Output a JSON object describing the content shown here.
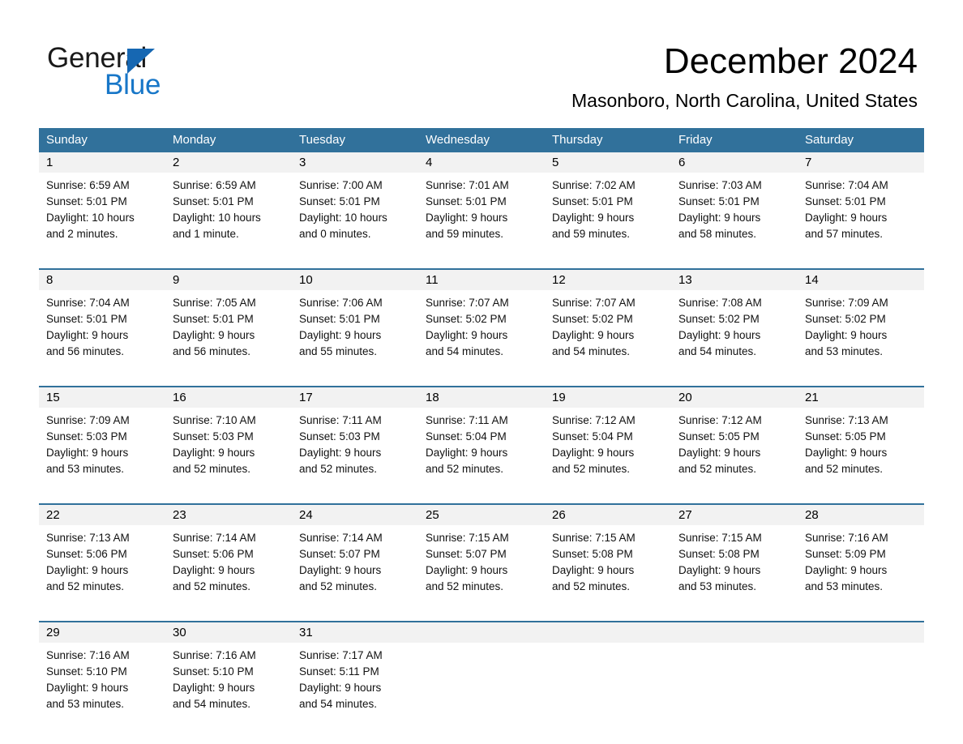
{
  "brand": {
    "name_part1": "General",
    "name_part2": "Blue",
    "accent_color": "#1877c8",
    "triangle_color": "#1667b2"
  },
  "header": {
    "title": "December 2024",
    "subtitle": "Masonboro, North Carolina, United States"
  },
  "calendar": {
    "header_bg": "#31719b",
    "header_text_color": "#ffffff",
    "daynumber_bg": "#f2f2f2",
    "weekdays": [
      "Sunday",
      "Monday",
      "Tuesday",
      "Wednesday",
      "Thursday",
      "Friday",
      "Saturday"
    ],
    "weeks": [
      [
        {
          "day": "1",
          "sunrise": "Sunrise: 6:59 AM",
          "sunset": "Sunset: 5:01 PM",
          "daylight_line1": "Daylight: 10 hours",
          "daylight_line2": "and 2 minutes."
        },
        {
          "day": "2",
          "sunrise": "Sunrise: 6:59 AM",
          "sunset": "Sunset: 5:01 PM",
          "daylight_line1": "Daylight: 10 hours",
          "daylight_line2": "and 1 minute."
        },
        {
          "day": "3",
          "sunrise": "Sunrise: 7:00 AM",
          "sunset": "Sunset: 5:01 PM",
          "daylight_line1": "Daylight: 10 hours",
          "daylight_line2": "and 0 minutes."
        },
        {
          "day": "4",
          "sunrise": "Sunrise: 7:01 AM",
          "sunset": "Sunset: 5:01 PM",
          "daylight_line1": "Daylight: 9 hours",
          "daylight_line2": "and 59 minutes."
        },
        {
          "day": "5",
          "sunrise": "Sunrise: 7:02 AM",
          "sunset": "Sunset: 5:01 PM",
          "daylight_line1": "Daylight: 9 hours",
          "daylight_line2": "and 59 minutes."
        },
        {
          "day": "6",
          "sunrise": "Sunrise: 7:03 AM",
          "sunset": "Sunset: 5:01 PM",
          "daylight_line1": "Daylight: 9 hours",
          "daylight_line2": "and 58 minutes."
        },
        {
          "day": "7",
          "sunrise": "Sunrise: 7:04 AM",
          "sunset": "Sunset: 5:01 PM",
          "daylight_line1": "Daylight: 9 hours",
          "daylight_line2": "and 57 minutes."
        }
      ],
      [
        {
          "day": "8",
          "sunrise": "Sunrise: 7:04 AM",
          "sunset": "Sunset: 5:01 PM",
          "daylight_line1": "Daylight: 9 hours",
          "daylight_line2": "and 56 minutes."
        },
        {
          "day": "9",
          "sunrise": "Sunrise: 7:05 AM",
          "sunset": "Sunset: 5:01 PM",
          "daylight_line1": "Daylight: 9 hours",
          "daylight_line2": "and 56 minutes."
        },
        {
          "day": "10",
          "sunrise": "Sunrise: 7:06 AM",
          "sunset": "Sunset: 5:01 PM",
          "daylight_line1": "Daylight: 9 hours",
          "daylight_line2": "and 55 minutes."
        },
        {
          "day": "11",
          "sunrise": "Sunrise: 7:07 AM",
          "sunset": "Sunset: 5:02 PM",
          "daylight_line1": "Daylight: 9 hours",
          "daylight_line2": "and 54 minutes."
        },
        {
          "day": "12",
          "sunrise": "Sunrise: 7:07 AM",
          "sunset": "Sunset: 5:02 PM",
          "daylight_line1": "Daylight: 9 hours",
          "daylight_line2": "and 54 minutes."
        },
        {
          "day": "13",
          "sunrise": "Sunrise: 7:08 AM",
          "sunset": "Sunset: 5:02 PM",
          "daylight_line1": "Daylight: 9 hours",
          "daylight_line2": "and 54 minutes."
        },
        {
          "day": "14",
          "sunrise": "Sunrise: 7:09 AM",
          "sunset": "Sunset: 5:02 PM",
          "daylight_line1": "Daylight: 9 hours",
          "daylight_line2": "and 53 minutes."
        }
      ],
      [
        {
          "day": "15",
          "sunrise": "Sunrise: 7:09 AM",
          "sunset": "Sunset: 5:03 PM",
          "daylight_line1": "Daylight: 9 hours",
          "daylight_line2": "and 53 minutes."
        },
        {
          "day": "16",
          "sunrise": "Sunrise: 7:10 AM",
          "sunset": "Sunset: 5:03 PM",
          "daylight_line1": "Daylight: 9 hours",
          "daylight_line2": "and 52 minutes."
        },
        {
          "day": "17",
          "sunrise": "Sunrise: 7:11 AM",
          "sunset": "Sunset: 5:03 PM",
          "daylight_line1": "Daylight: 9 hours",
          "daylight_line2": "and 52 minutes."
        },
        {
          "day": "18",
          "sunrise": "Sunrise: 7:11 AM",
          "sunset": "Sunset: 5:04 PM",
          "daylight_line1": "Daylight: 9 hours",
          "daylight_line2": "and 52 minutes."
        },
        {
          "day": "19",
          "sunrise": "Sunrise: 7:12 AM",
          "sunset": "Sunset: 5:04 PM",
          "daylight_line1": "Daylight: 9 hours",
          "daylight_line2": "and 52 minutes."
        },
        {
          "day": "20",
          "sunrise": "Sunrise: 7:12 AM",
          "sunset": "Sunset: 5:05 PM",
          "daylight_line1": "Daylight: 9 hours",
          "daylight_line2": "and 52 minutes."
        },
        {
          "day": "21",
          "sunrise": "Sunrise: 7:13 AM",
          "sunset": "Sunset: 5:05 PM",
          "daylight_line1": "Daylight: 9 hours",
          "daylight_line2": "and 52 minutes."
        }
      ],
      [
        {
          "day": "22",
          "sunrise": "Sunrise: 7:13 AM",
          "sunset": "Sunset: 5:06 PM",
          "daylight_line1": "Daylight: 9 hours",
          "daylight_line2": "and 52 minutes."
        },
        {
          "day": "23",
          "sunrise": "Sunrise: 7:14 AM",
          "sunset": "Sunset: 5:06 PM",
          "daylight_line1": "Daylight: 9 hours",
          "daylight_line2": "and 52 minutes."
        },
        {
          "day": "24",
          "sunrise": "Sunrise: 7:14 AM",
          "sunset": "Sunset: 5:07 PM",
          "daylight_line1": "Daylight: 9 hours",
          "daylight_line2": "and 52 minutes."
        },
        {
          "day": "25",
          "sunrise": "Sunrise: 7:15 AM",
          "sunset": "Sunset: 5:07 PM",
          "daylight_line1": "Daylight: 9 hours",
          "daylight_line2": "and 52 minutes."
        },
        {
          "day": "26",
          "sunrise": "Sunrise: 7:15 AM",
          "sunset": "Sunset: 5:08 PM",
          "daylight_line1": "Daylight: 9 hours",
          "daylight_line2": "and 52 minutes."
        },
        {
          "day": "27",
          "sunrise": "Sunrise: 7:15 AM",
          "sunset": "Sunset: 5:08 PM",
          "daylight_line1": "Daylight: 9 hours",
          "daylight_line2": "and 53 minutes."
        },
        {
          "day": "28",
          "sunrise": "Sunrise: 7:16 AM",
          "sunset": "Sunset: 5:09 PM",
          "daylight_line1": "Daylight: 9 hours",
          "daylight_line2": "and 53 minutes."
        }
      ],
      [
        {
          "day": "29",
          "sunrise": "Sunrise: 7:16 AM",
          "sunset": "Sunset: 5:10 PM",
          "daylight_line1": "Daylight: 9 hours",
          "daylight_line2": "and 53 minutes."
        },
        {
          "day": "30",
          "sunrise": "Sunrise: 7:16 AM",
          "sunset": "Sunset: 5:10 PM",
          "daylight_line1": "Daylight: 9 hours",
          "daylight_line2": "and 54 minutes."
        },
        {
          "day": "31",
          "sunrise": "Sunrise: 7:17 AM",
          "sunset": "Sunset: 5:11 PM",
          "daylight_line1": "Daylight: 9 hours",
          "daylight_line2": "and 54 minutes."
        },
        {
          "day": "",
          "sunrise": "",
          "sunset": "",
          "daylight_line1": "",
          "daylight_line2": ""
        },
        {
          "day": "",
          "sunrise": "",
          "sunset": "",
          "daylight_line1": "",
          "daylight_line2": ""
        },
        {
          "day": "",
          "sunrise": "",
          "sunset": "",
          "daylight_line1": "",
          "daylight_line2": ""
        },
        {
          "day": "",
          "sunrise": "",
          "sunset": "",
          "daylight_line1": "",
          "daylight_line2": ""
        }
      ]
    ]
  }
}
